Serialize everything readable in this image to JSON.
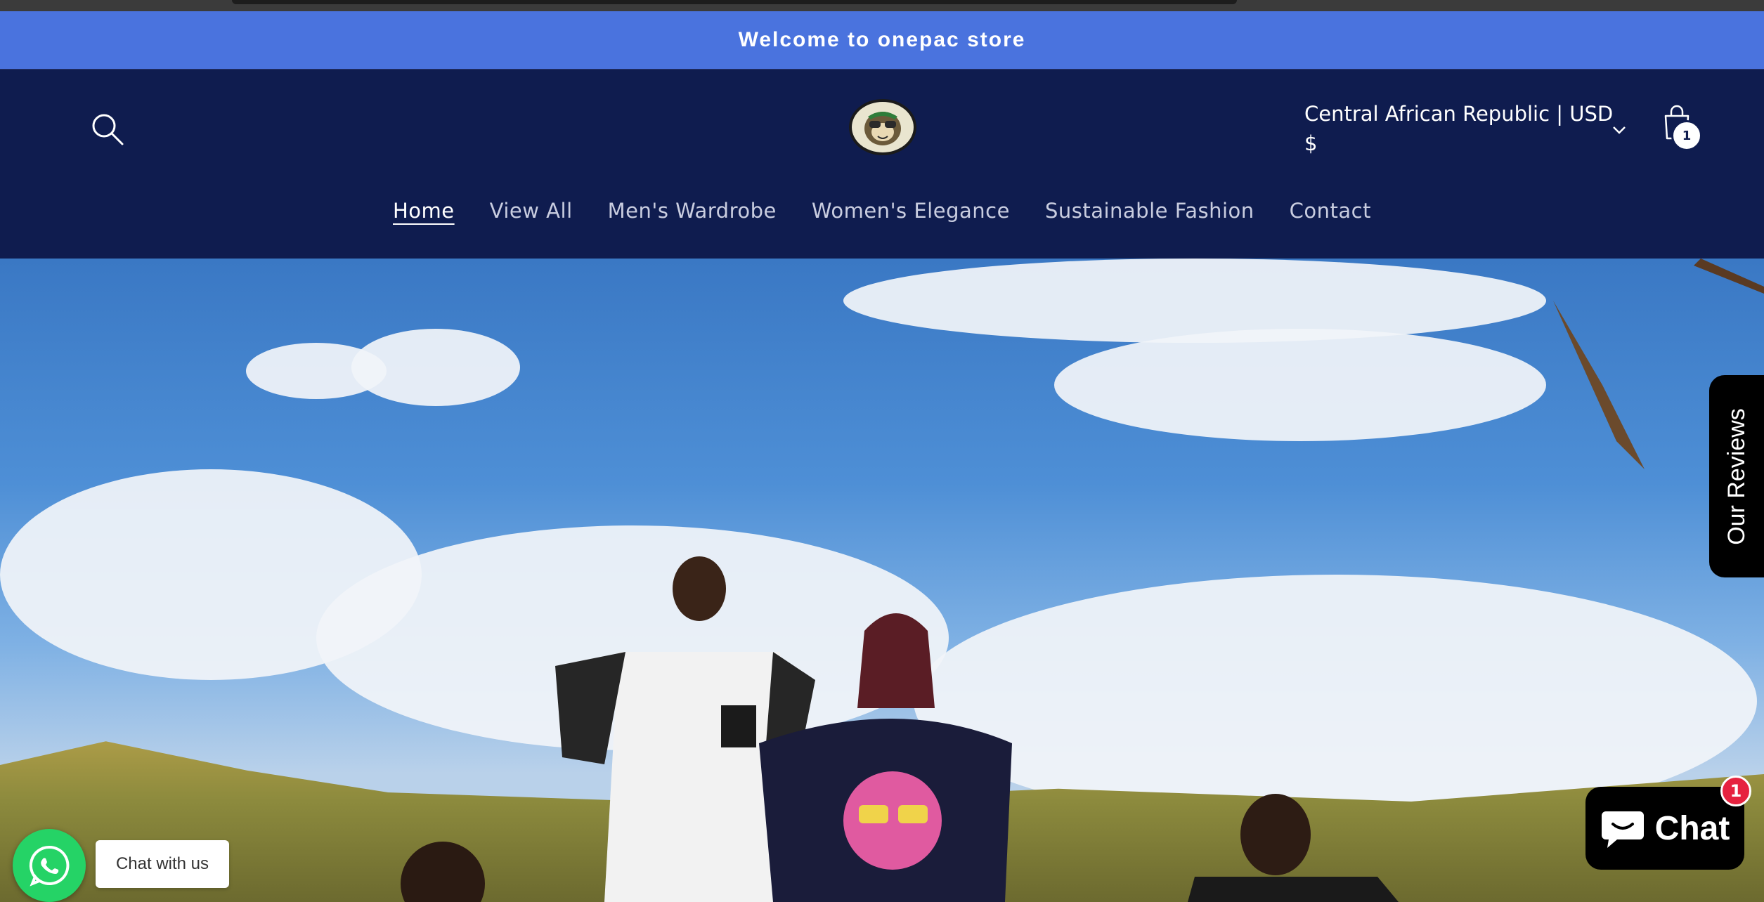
{
  "announcement": {
    "text": "Welcome to onepac store"
  },
  "header": {
    "country_selector": {
      "label": "Central African Republic | USD $"
    },
    "cart": {
      "count": "1"
    },
    "nav": [
      {
        "label": "Home",
        "active": true
      },
      {
        "label": "View All"
      },
      {
        "label": "Men's Wardrobe"
      },
      {
        "label": "Women's Elegance"
      },
      {
        "label": "Sustainable Fashion"
      },
      {
        "label": "Contact"
      }
    ]
  },
  "widgets": {
    "reviews_tab": {
      "label": "Our Reviews"
    },
    "whatsapp": {
      "label": "Chat with us"
    },
    "shopify_chat": {
      "label": "Chat",
      "badge": "1"
    }
  },
  "colors": {
    "announcement_bg": "#4a73de",
    "header_bg": "#0f1c4f",
    "whatsapp_green": "#25d366",
    "chat_badge_red": "#e6223f"
  }
}
